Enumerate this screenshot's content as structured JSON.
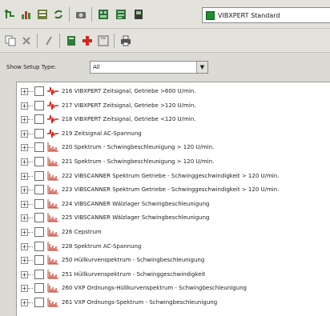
{
  "toolbar": {
    "device_select_value": "VIBXPERT Standard"
  },
  "filter": {
    "label": "Show Setup Type:",
    "value": "All"
  },
  "tree": {
    "items": [
      {
        "label": "216 VIBXPERT Zeitsignal, Getriebe >600 U/min.",
        "icon": "signal-icon"
      },
      {
        "label": "217 VIBXPERT Zeitsignal, Getriebe >120 U/min.",
        "icon": "signal-icon"
      },
      {
        "label": "218 VIBXPERT Zeitsignal, Getriebe <120 U/min.",
        "icon": "signal-icon"
      },
      {
        "label": "219 Zeitsignal AC-Spannung",
        "icon": "signal-icon"
      },
      {
        "label": "220 Spektrum - Schwingbeschleunigung > 120 U/min.",
        "icon": "spectrum-icon"
      },
      {
        "label": "221 Spektrum - Schwingbeschleunigung > 120 U/min.",
        "icon": "spectrum-icon"
      },
      {
        "label": "222 VIBSCANNER Spektrum Getriebe - Schwinggeschwindigkeit > 120 U/min.",
        "icon": "spectrum-icon"
      },
      {
        "label": "223 VIBSCANNER Spektrum Getriebe - Schwinggeschwindigkeit > 120 U/min.",
        "icon": "spectrum-icon"
      },
      {
        "label": "224 VIBSCANNER Wälzlager Schwingbeschleunigung",
        "icon": "spectrum-icon"
      },
      {
        "label": "225 VIBSCANNER Wälzlager Schwingbeschleunigung",
        "icon": "spectrum-icon"
      },
      {
        "label": "226 Cepstrum",
        "icon": "spectrum-icon"
      },
      {
        "label": "228 Spektrum AC-Spannung",
        "icon": "spectrum-icon"
      },
      {
        "label": "250 Hüllkurvenspektrum - Schwingbeschleunigung",
        "icon": "spectrum-icon"
      },
      {
        "label": "251 Hüllkurvenspektrum - Schwinggeschwindigkeit",
        "icon": "spectrum-icon"
      },
      {
        "label": "260 VXP Ordnungs-Hüllkurvenspektrum - Schwingbeschleunigung",
        "icon": "spectrum-icon"
      },
      {
        "label": "261 VXP Ordnungs-Spektrum - Schwingbeschleunigung",
        "icon": "spectrum-icon"
      }
    ]
  }
}
